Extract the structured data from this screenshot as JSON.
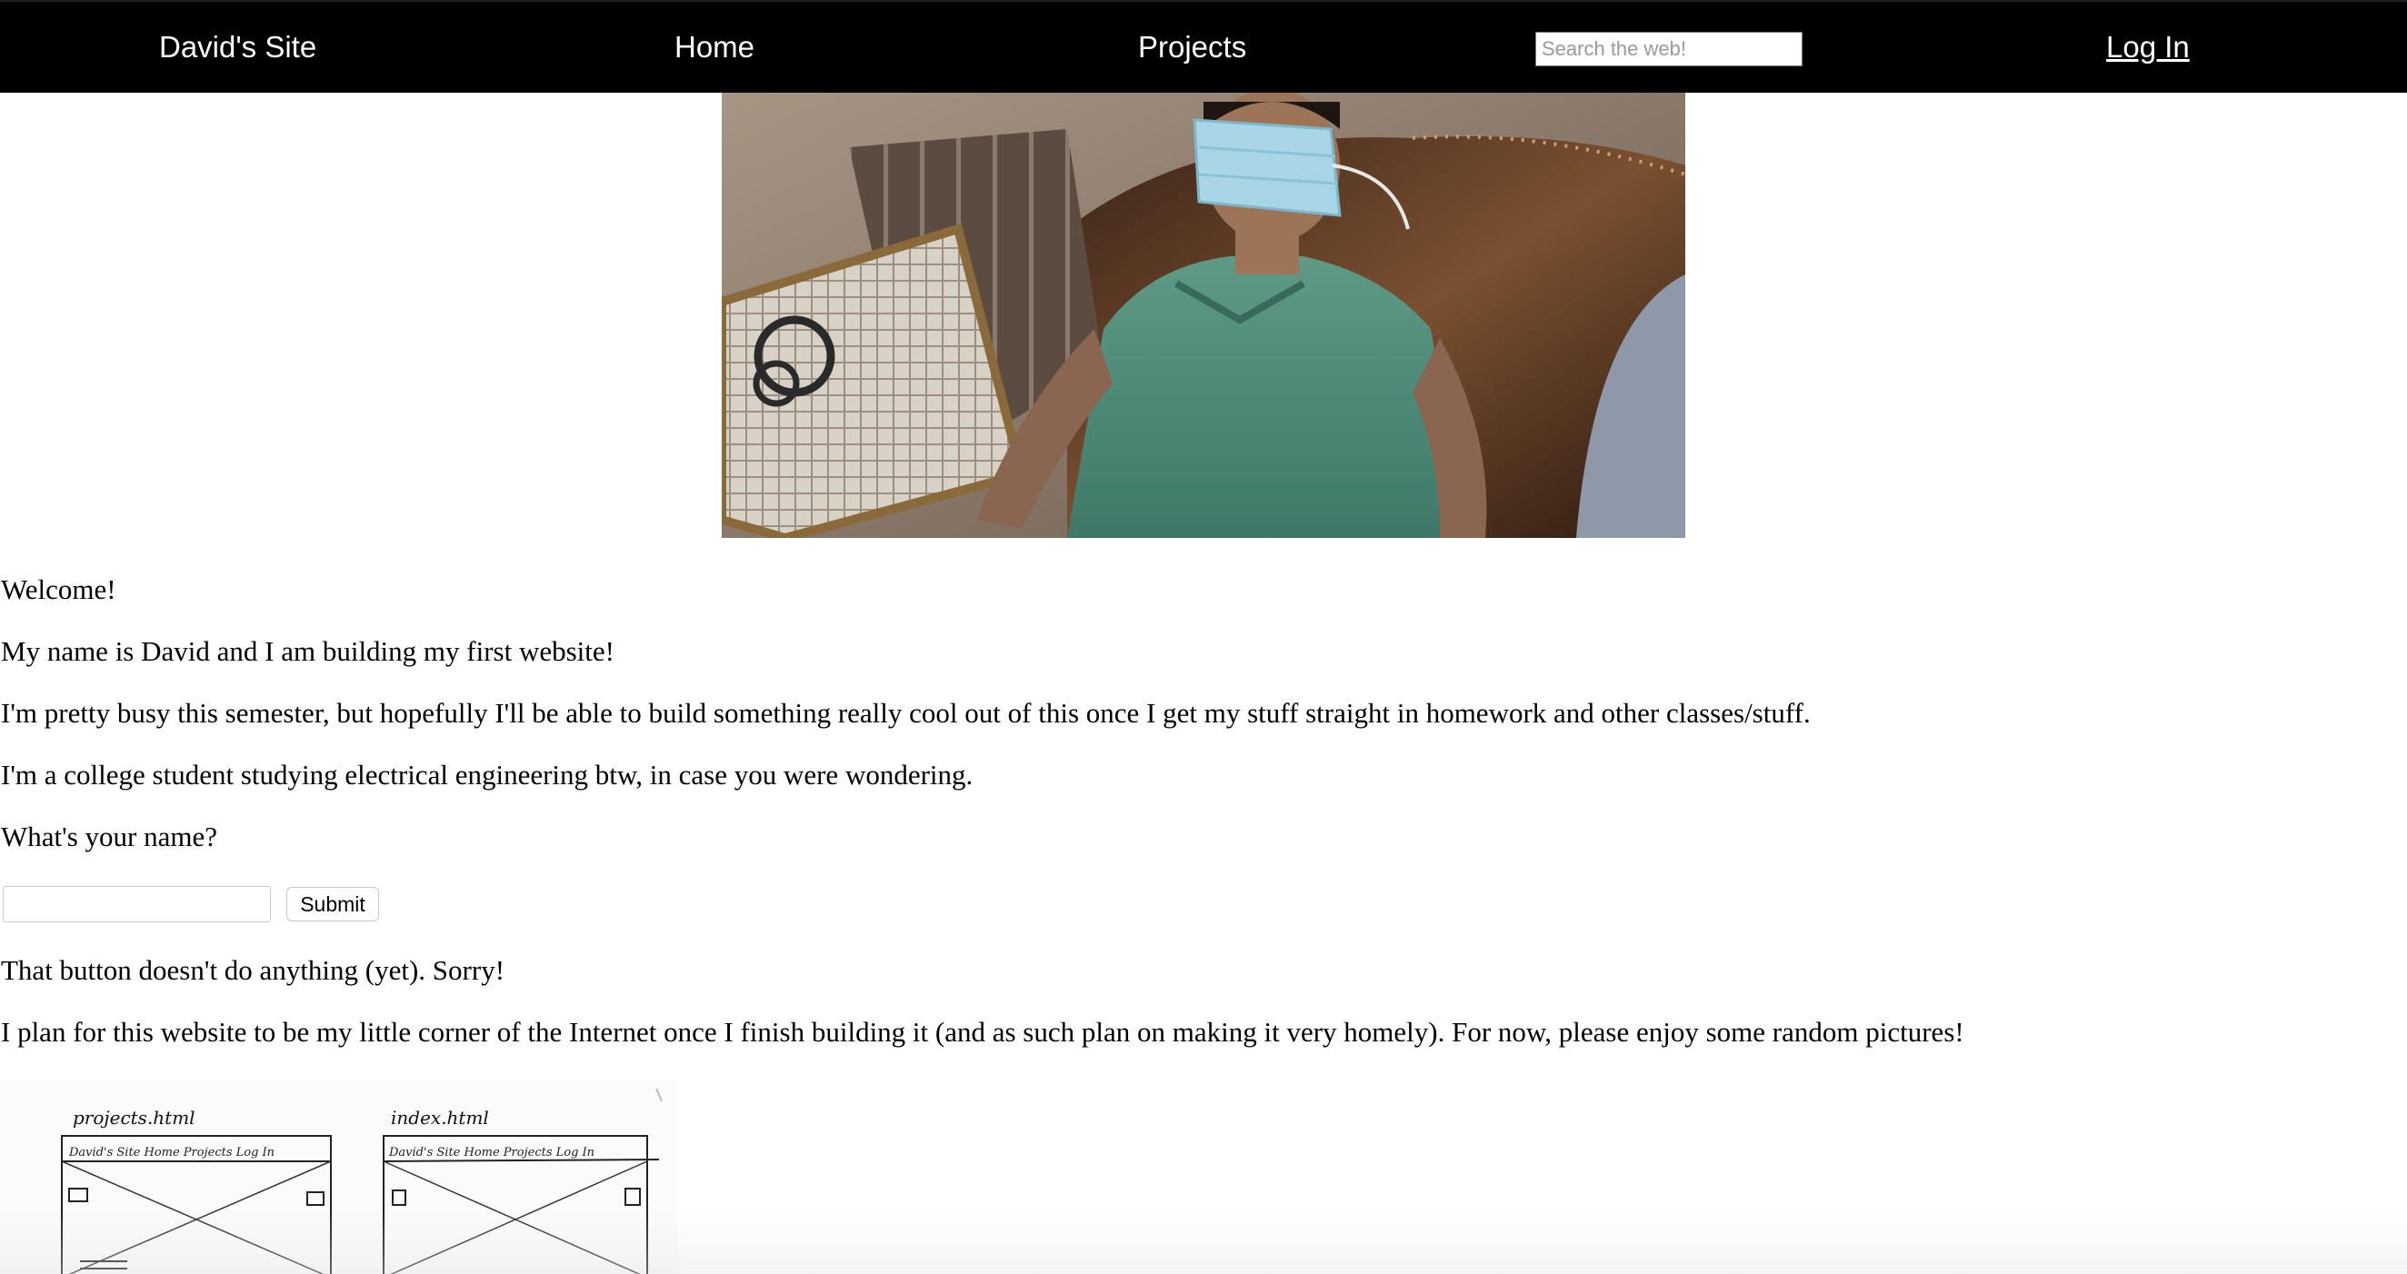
{
  "nav": {
    "brand": "David's Site",
    "home": "Home",
    "projects": "Projects",
    "search_placeholder": "Search the web!",
    "login": "Log In"
  },
  "hero": {
    "description_icon": "photo-person-with-mask-over-eyes"
  },
  "content": {
    "welcome": "Welcome!",
    "intro": "My name is David and I am building my first website!",
    "busy": "I'm pretty busy this semester, but hopefully I'll be able to build something really cool out of this once I get my stuff straight in homework and other classes/stuff.",
    "student": "I'm a college student studying electrical engineering btw, in case you were wondering.",
    "question": "What's your name?",
    "name_value": "",
    "submit_label": "Submit",
    "sorry": "That button doesn't do anything (yet). Sorry!",
    "plan": "I plan for this website to be my little corner of the Internet once I finish building it (and as such plan on making it very homely). For now, please enjoy some random pictures!"
  },
  "sketch": {
    "label_left": "projects.html",
    "label_right": "index.html",
    "mini_nav_left": "David's Site Home Projects Log In",
    "mini_nav_right": "David's Site Home Projects Log In"
  }
}
